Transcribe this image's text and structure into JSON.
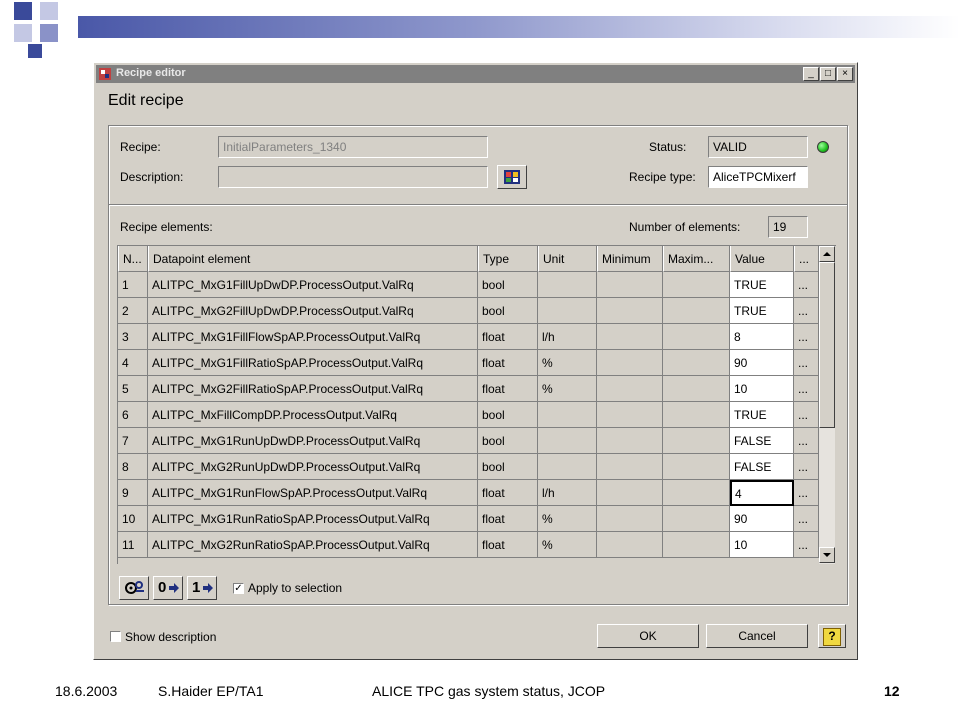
{
  "window": {
    "title": "Recipe editor",
    "heading": "Edit recipe",
    "minimize": "_",
    "maximize": "□",
    "close": "×"
  },
  "form": {
    "recipe_label": "Recipe:",
    "recipe_value": "InitialParameters_1340",
    "description_label": "Description:",
    "description_value": "",
    "status_label": "Status:",
    "status_value": "VALID",
    "status_color": "#1fbf1f",
    "recipe_type_label": "Recipe type:",
    "recipe_type_value": "AliceTPCMixerf",
    "elements_label": "Recipe elements:",
    "count_label": "Number of elements:",
    "count_value": "19"
  },
  "table": {
    "columns": [
      "N...",
      "Datapoint element",
      "Type",
      "Unit",
      "Minimum",
      "Maxim...",
      "Value",
      "..."
    ],
    "rows": [
      [
        "1",
        "ALITPC_MxG1FillUpDwDP.ProcessOutput.ValRq",
        "bool",
        "",
        "",
        "",
        "TRUE",
        "..."
      ],
      [
        "2",
        "ALITPC_MxG2FillUpDwDP.ProcessOutput.ValRq",
        "bool",
        "",
        "",
        "",
        "TRUE",
        "..."
      ],
      [
        "3",
        "ALITPC_MxG1FillFlowSpAP.ProcessOutput.ValRq",
        "float",
        "l/h",
        "",
        "",
        "8",
        "..."
      ],
      [
        "4",
        "ALITPC_MxG1FillRatioSpAP.ProcessOutput.ValRq",
        "float",
        "%",
        "",
        "",
        "90",
        "..."
      ],
      [
        "5",
        "ALITPC_MxG2FillRatioSpAP.ProcessOutput.ValRq",
        "float",
        "%",
        "",
        "",
        "10",
        "..."
      ],
      [
        "6",
        "ALITPC_MxFillCompDP.ProcessOutput.ValRq",
        "bool",
        "",
        "",
        "",
        "TRUE",
        "..."
      ],
      [
        "7",
        "ALITPC_MxG1RunUpDwDP.ProcessOutput.ValRq",
        "bool",
        "",
        "",
        "",
        "FALSE",
        "..."
      ],
      [
        "8",
        "ALITPC_MxG2RunUpDwDP.ProcessOutput.ValRq",
        "bool",
        "",
        "",
        "",
        "FALSE",
        "..."
      ],
      [
        "9",
        "ALITPC_MxG1RunFlowSpAP.ProcessOutput.ValRq",
        "float",
        "l/h",
        "",
        "",
        "4",
        "..."
      ],
      [
        "10",
        "ALITPC_MxG1RunRatioSpAP.ProcessOutput.ValRq",
        "float",
        "%",
        "",
        "",
        "90",
        "..."
      ],
      [
        "11",
        "ALITPC_MxG2RunRatioSpAP.ProcessOutput.ValRq",
        "float",
        "%",
        "",
        "",
        "10",
        "..."
      ]
    ],
    "selected_row": 9
  },
  "toolbar": {
    "zero_label": "0",
    "one_label": "1",
    "apply_label": "Apply to selection",
    "apply_checked": "✓"
  },
  "bottom": {
    "show_description_label": "Show description",
    "ok_label": "OK",
    "cancel_label": "Cancel",
    "help_label": "?"
  },
  "footer": {
    "date": "18.6.2003",
    "author": "S.Haider EP/TA1",
    "title": "ALICE TPC gas system status, JCOP",
    "page": "12"
  }
}
